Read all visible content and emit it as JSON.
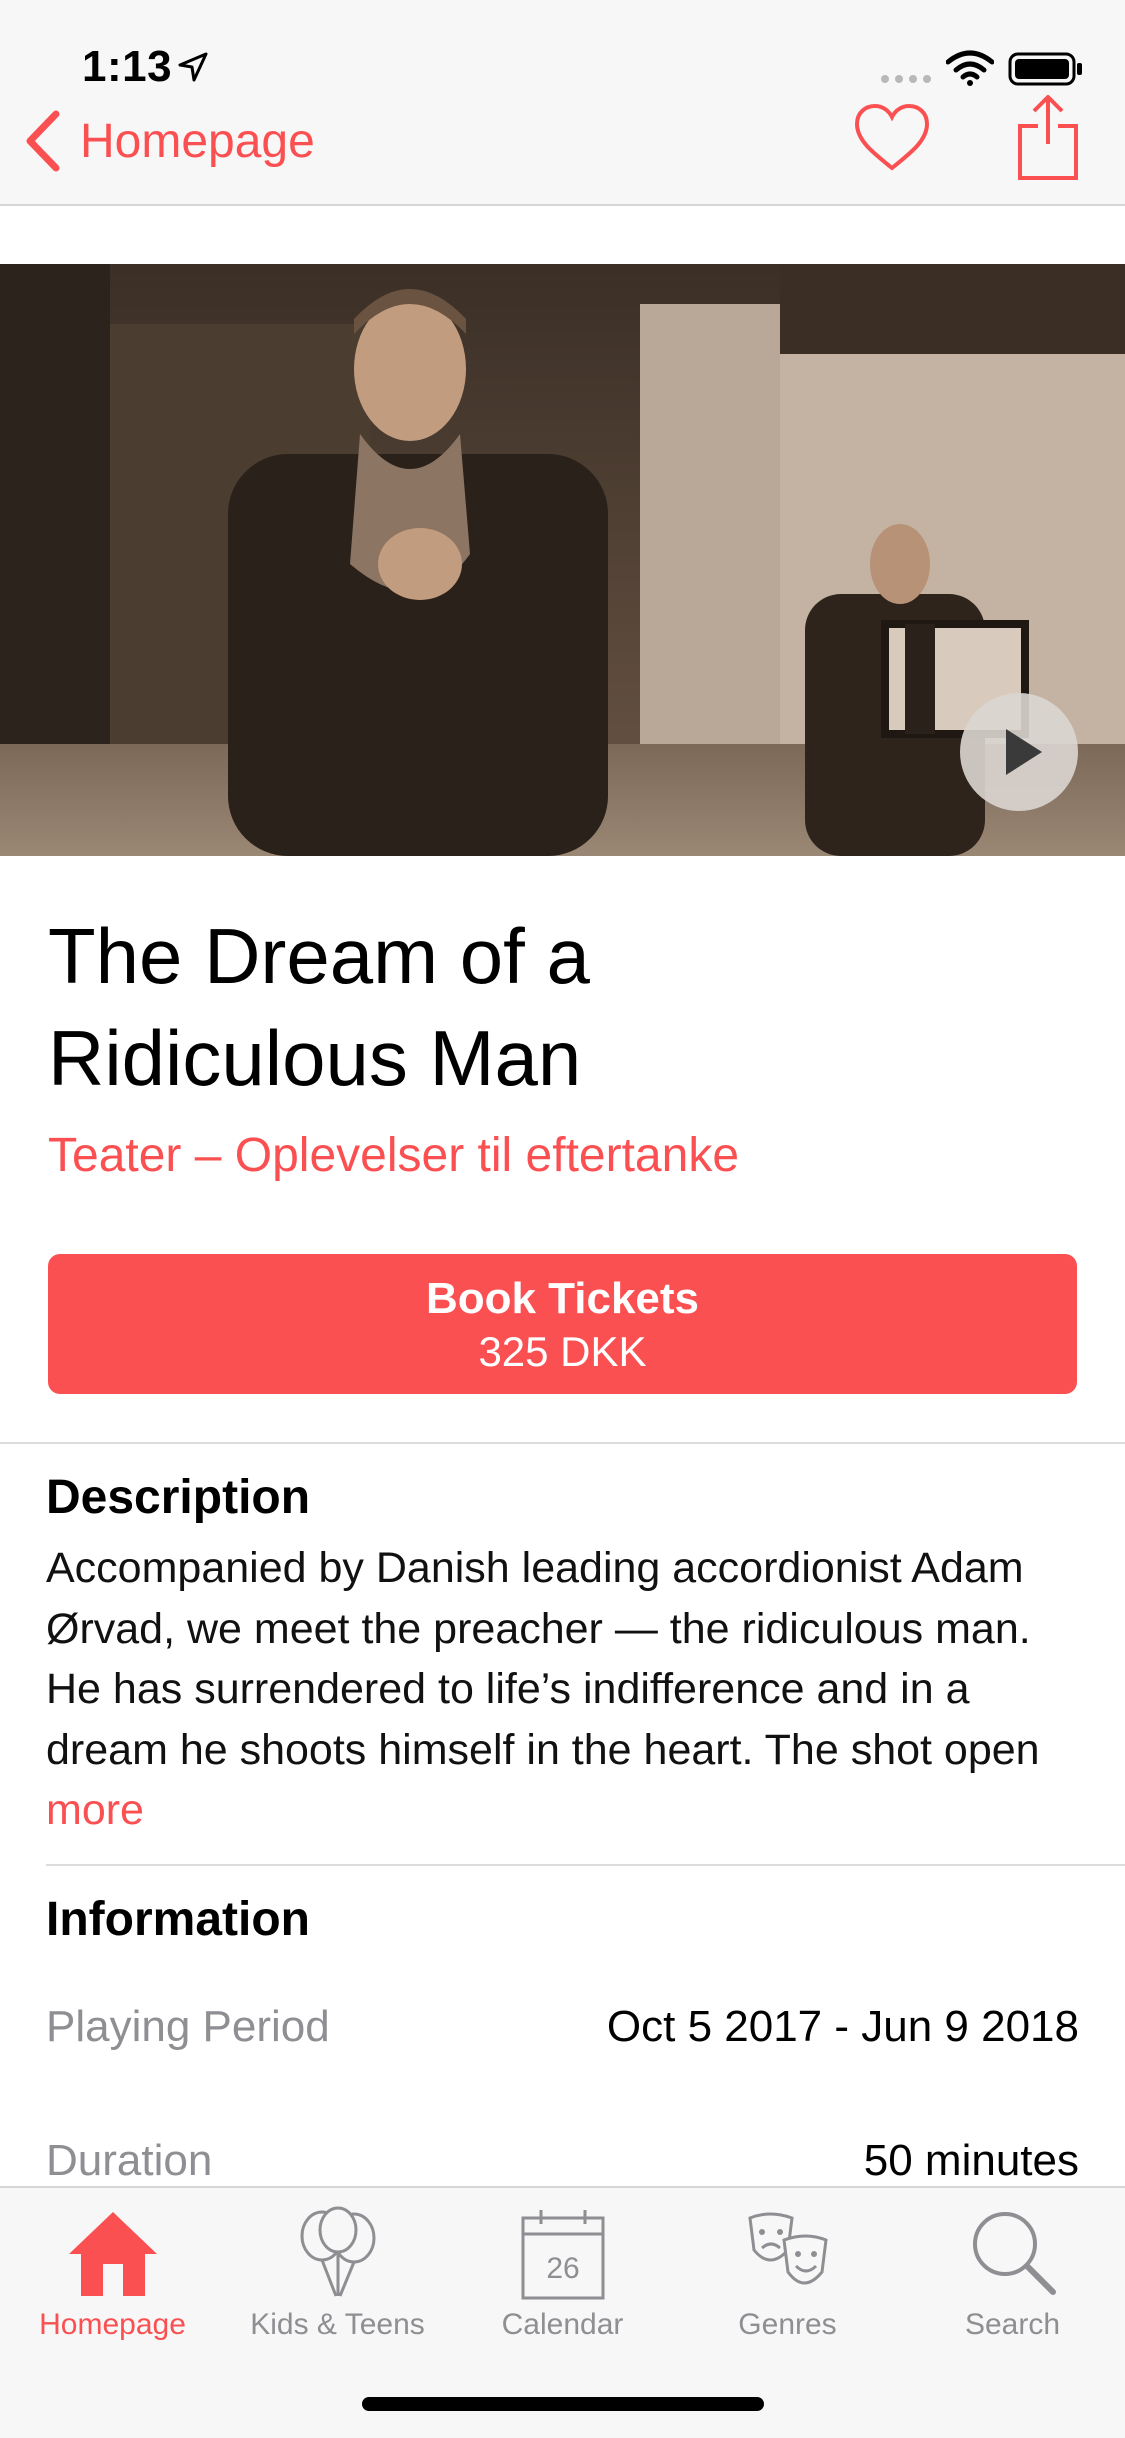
{
  "status_bar": {
    "time": "1:13"
  },
  "nav": {
    "back_label": "Homepage"
  },
  "event": {
    "title_line1": "The Dream of a",
    "title_line2": "Ridiculous Man",
    "subtitle": "Teater – Oplevelser til eftertanke"
  },
  "booking": {
    "label": "Book Tickets",
    "price": "325 DKK"
  },
  "description": {
    "heading": "Description",
    "text": "Accompanied by Danish leading accordionist Adam Ørvad, we meet the preacher — the ridiculous man. He has surrendered to life’s indifference and in a dream he shoots himself in the heart. The shot open",
    "more_label": "more"
  },
  "information": {
    "heading": "Information",
    "rows": [
      {
        "label": "Playing Period",
        "value": "Oct 5 2017 - Jun 9 2018"
      },
      {
        "label": "Duration",
        "value": "50 minutes"
      }
    ]
  },
  "tabs": [
    {
      "label": "Homepage",
      "icon": "house-icon",
      "active": true
    },
    {
      "label": "Kids & Teens",
      "icon": "balloons-icon",
      "active": false
    },
    {
      "label": "Calendar",
      "icon": "calendar-icon",
      "calendar_day": "26",
      "active": false
    },
    {
      "label": "Genres",
      "icon": "theater-masks-icon",
      "active": false
    },
    {
      "label": "Search",
      "icon": "search-icon",
      "active": false
    }
  ],
  "colors": {
    "accent": "#fb5052",
    "muted": "#8e8e93",
    "bar_background": "#f7f7f7"
  }
}
